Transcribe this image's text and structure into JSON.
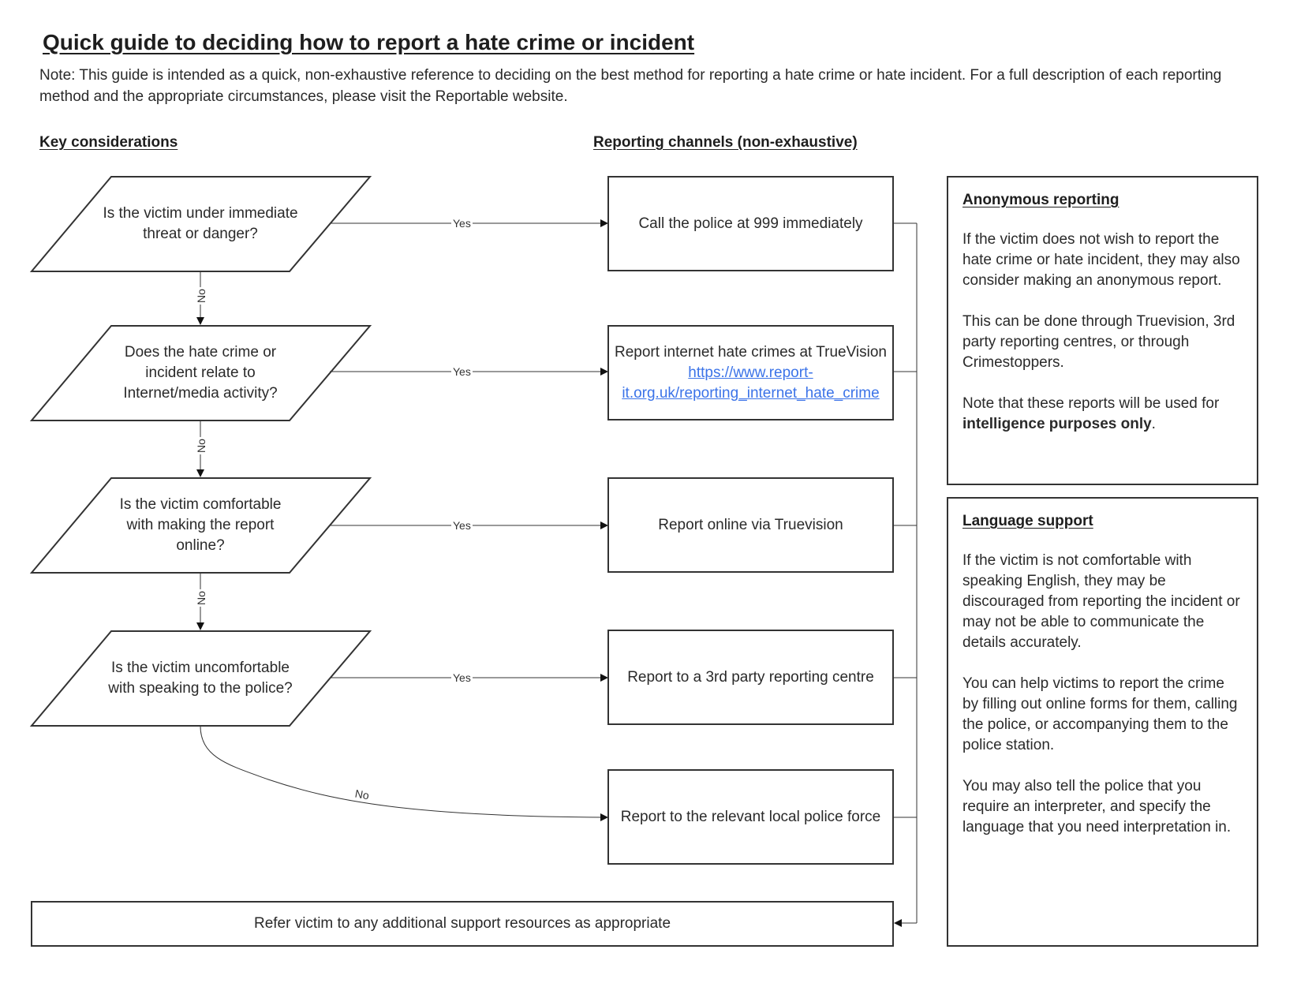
{
  "title": "Quick guide to deciding how to report a hate crime or incident",
  "note": "Note: This guide is intended as a quick, non-exhaustive reference to deciding on the best method for reporting a hate crime or hate incident. For a full description of each reporting method and the appropriate circumstances, please visit the Reportable website.",
  "columns": {
    "key_considerations": "Key considerations",
    "reporting_channels": "Reporting channels (non-exhaustive)"
  },
  "questions": [
    {
      "text": "Is the victim under immediate threat or danger?"
    },
    {
      "text": "Does the hate crime or incident relate to Internet/media activity?"
    },
    {
      "text": "Is the victim comfortable with making the report online?"
    },
    {
      "text": "Is the victim uncomfortable with speaking to the police?"
    }
  ],
  "edge_labels": {
    "yes": "Yes",
    "no": "No"
  },
  "channels": [
    {
      "text": "Call the police at 999 immediately"
    },
    {
      "text_before": "Report internet hate crimes at TrueVision ",
      "link": "https://www.report-it.org.uk/reporting_internet_hate_crime"
    },
    {
      "text": "Report online via Truevision"
    },
    {
      "text": "Report to a 3rd party reporting centre"
    },
    {
      "text": "Report to the relevant local police force"
    }
  ],
  "final_step": "Refer victim to any additional support resources as appropriate",
  "anonymous": {
    "heading": "Anonymous reporting",
    "p1": "If the victim does not wish to report the hate crime or hate incident, they may also consider making an anonymous report.",
    "p2": "This can be done through Truevision, 3rd party reporting centres, or through Crimestoppers.",
    "p3_before": "Note that these reports will be used for ",
    "p3_bold": "intelligence purposes only",
    "p3_after": "."
  },
  "language": {
    "heading": "Language support",
    "p1": "If the victim is not comfortable with speaking English, they may be discouraged from reporting the incident or may not be able to communicate the details accurately.",
    "p2": "You can help victims to report the crime by filling out online forms for them, calling the police, or accompanying them to the police station.",
    "p3": "You may also tell the police that you require an interpreter, and specify the language that you need interpretation in."
  },
  "colors": {
    "line": "#333333",
    "link": "#3b73e8",
    "text": "#2a2a2a"
  }
}
